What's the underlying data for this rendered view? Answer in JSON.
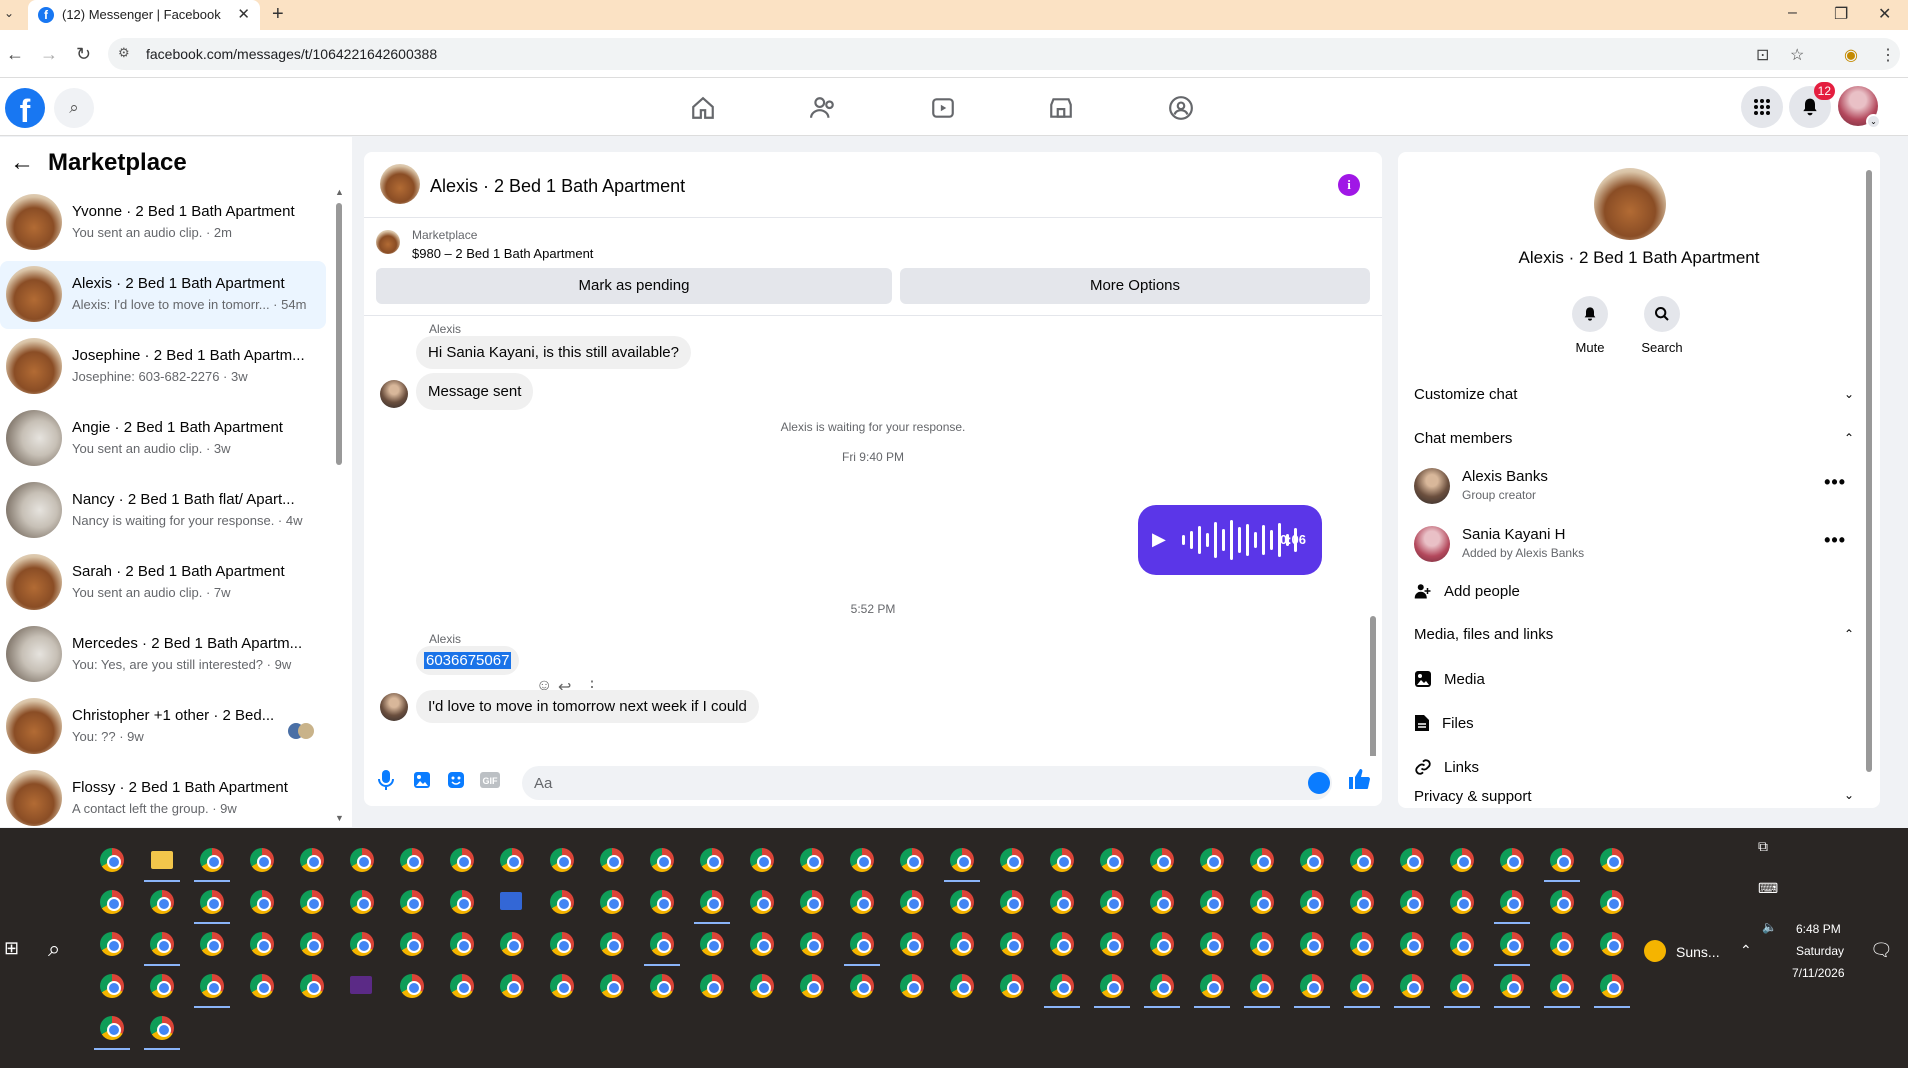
{
  "browser": {
    "tab_title": "(12) Messenger | Facebook",
    "url": "facebook.com/messages/t/1064221642600388",
    "window_controls": [
      "–",
      "❐",
      "✕"
    ]
  },
  "topbar": {
    "notifications_count": "12",
    "nav_icons": [
      "home-icon",
      "friends-icon",
      "video-icon",
      "marketplace-icon",
      "groups-icon"
    ]
  },
  "sidebar": {
    "title": "Marketplace",
    "conversations": [
      {
        "name": "Yvonne · 2 Bed 1 Bath Apartment",
        "snippet": "You sent an audio clip. · 2m",
        "active": false,
        "thumb": "room"
      },
      {
        "name": "Alexis · 2 Bed 1 Bath Apartment",
        "snippet": "Alexis: I'd love to move in tomorr... · 54m",
        "active": true,
        "thumb": "room"
      },
      {
        "name": "Josephine · 2 Bed 1 Bath Apartm...",
        "snippet": "Josephine: 603-682-2276 · 3w",
        "active": false,
        "thumb": "room"
      },
      {
        "name": "Angie · 2 Bed 1 Bath Apartment",
        "snippet": "You sent an audio clip. · 3w",
        "active": false,
        "thumb": "white"
      },
      {
        "name": "Nancy · 2 Bed 1 Bath flat/ Apart...",
        "snippet": "Nancy is waiting for your response. · 4w",
        "active": false,
        "thumb": "white"
      },
      {
        "name": "Sarah · 2 Bed 1 Bath Apartment",
        "snippet": "You sent an audio clip. · 7w",
        "active": false,
        "thumb": "room"
      },
      {
        "name": "Mercedes · 2 Bed 1 Bath Apartm...",
        "snippet": "You: Yes, are you still interested? · 9w",
        "active": false,
        "thumb": "white"
      },
      {
        "name": "Christopher +1 other · 2 Bed...",
        "snippet": "You: ?? · 9w",
        "active": false,
        "thumb": "room"
      },
      {
        "name": "Flossy · 2 Bed 1 Bath Apartment",
        "snippet": "A contact left the group. · 9w",
        "active": false,
        "thumb": "room"
      }
    ]
  },
  "chat": {
    "title": "Alexis · 2 Bed 1 Bath Apartment",
    "marketplace_label": "Marketplace",
    "listing": "$980 – 2 Bed 1 Bath Apartment",
    "mark_pending": "Mark as pending",
    "more_options": "More Options",
    "sender1": "Alexis",
    "msg1": "Hi Sania Kayani, is this still available?",
    "msg2": "Message sent",
    "waiting": "Alexis is waiting for your response.",
    "time1": "Fri 9:40 PM",
    "audio_duration": "0:06",
    "time2": "5:52 PM",
    "sender2": "Alexis",
    "msg3": "6036675067",
    "msg4": "I'd love to move in tomorrow next week if I could",
    "composer_placeholder": "Aa"
  },
  "details": {
    "name": "Alexis · 2 Bed 1 Bath Apartment",
    "mute": "Mute",
    "search": "Search",
    "customize": "Customize chat",
    "members_title": "Chat members",
    "members": [
      {
        "name": "Alexis Banks",
        "sub": "Group creator"
      },
      {
        "name": "Sania Kayani H",
        "sub": "Added by Alexis Banks"
      }
    ],
    "add_people": "Add people",
    "media_title": "Media, files and links",
    "media": "Media",
    "files": "Files",
    "links": "Links",
    "privacy": "Privacy & support"
  },
  "taskbar": {
    "weather": "Suns...",
    "time": "6:48 PM",
    "day": "Saturday",
    "date": "7/11/2026"
  }
}
